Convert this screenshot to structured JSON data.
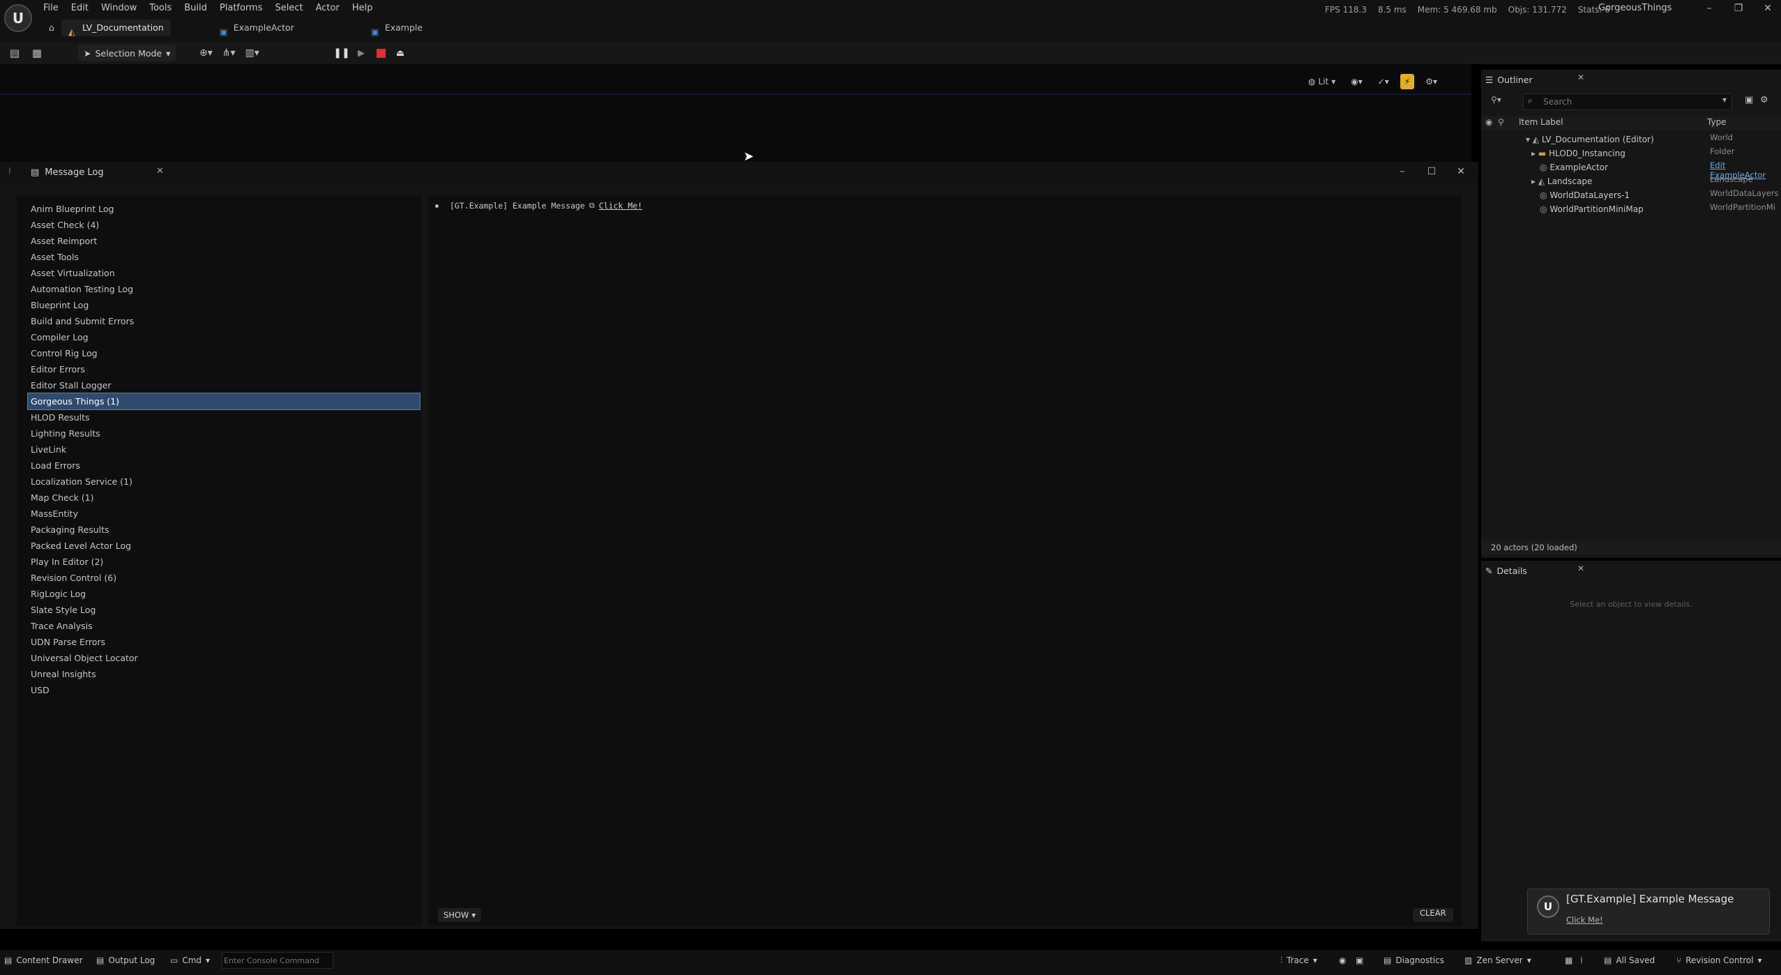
{
  "menu": [
    "File",
    "Edit",
    "Window",
    "Tools",
    "Build",
    "Platforms",
    "Select",
    "Actor",
    "Help"
  ],
  "tabs": [
    {
      "label": "LV_Documentation",
      "icon": "level-icon"
    },
    {
      "label": "ExampleActor",
      "icon": "blueprint-icon"
    },
    {
      "label": "Example",
      "icon": "blueprint-icon"
    }
  ],
  "stats": {
    "fps": "FPS 118.3",
    "ms": "8.5 ms",
    "mem": "Mem: 5 469.68 mb",
    "objs": "Objs: 131.772",
    "stats": "Stats: 6"
  },
  "project_name": "GorgeousThings",
  "toolbar": {
    "selection_mode": "Selection Mode"
  },
  "viewport": {
    "lit_label": "Lit"
  },
  "message_log": {
    "title": "Message Log",
    "categories": [
      "Anim Blueprint Log",
      "Asset Check (4)",
      "Asset Reimport",
      "Asset Tools",
      "Asset Virtualization",
      "Automation Testing Log",
      "Blueprint Log",
      "Build and Submit Errors",
      "Compiler Log",
      "Control Rig Log",
      "Editor Errors",
      "Editor Stall Logger",
      "Gorgeous Things (1)",
      "HLOD Results",
      "Lighting Results",
      "LiveLink",
      "Load Errors",
      "Localization Service (1)",
      "Map Check (1)",
      "MassEntity",
      "Packaging Results",
      "Packed Level Actor Log",
      "Play In Editor (2)",
      "Revision Control (6)",
      "RigLogic Log",
      "Slate Style Log",
      "Trace Analysis",
      "UDN Parse Errors",
      "Universal Object Locator",
      "Unreal Insights",
      "USD"
    ],
    "selected_category": "Gorgeous Things (1)",
    "message": {
      "text": "[GT.Example] Example Message",
      "link": "Click Me!"
    },
    "show_label": "SHOW",
    "clear_label": "CLEAR"
  },
  "outliner": {
    "title": "Outliner",
    "search_placeholder": "Search",
    "col_label": "Item Label",
    "col_type": "Type",
    "rows": [
      {
        "label": "LV_Documentation (Editor)",
        "type": "World"
      },
      {
        "label": "HLOD0_Instancing",
        "type": "Folder"
      },
      {
        "label": "ExampleActor",
        "type": "Edit ExampleActor"
      },
      {
        "label": "Landscape",
        "type": "Landscape"
      },
      {
        "label": "WorldDataLayers-1",
        "type": "WorldDataLayers"
      },
      {
        "label": "WorldPartitionMiniMap",
        "type": "WorldPartitionMi"
      }
    ],
    "footer": "20 actors (20 loaded)"
  },
  "details": {
    "title": "Details",
    "empty_text": "Select an object to view details."
  },
  "toast": {
    "title": "[GT.Example] Example Message",
    "link": "Click Me!"
  },
  "statusbar": {
    "content_drawer": "Content Drawer",
    "output_log": "Output Log",
    "cmd": "Cmd",
    "cmd_placeholder": "Enter Console Command",
    "trace": "Trace",
    "diagnostics": "Diagnostics",
    "zen_server": "Zen Server",
    "all_saved": "All Saved",
    "revision_control": "Revision Control"
  }
}
